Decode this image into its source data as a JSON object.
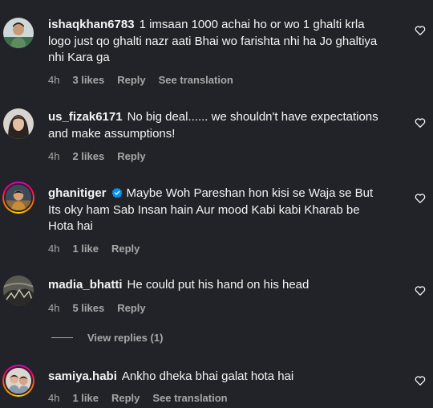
{
  "comments": [
    {
      "username": "ishaqkhan6783",
      "text": "1 imsaan 1000 achai ho or wo 1 ghalti krla logo just qo ghalti nazr aati Bhai wo farishta nhi ha Jo ghaltiya nhi Kara ga",
      "time": "4h",
      "likes": "3 likes",
      "reply": "Reply",
      "translate": "See translation"
    },
    {
      "username": "us_fizak6171",
      "text": "No big deal...... we shouldn't have expectations and make assumptions!",
      "time": "4h",
      "likes": "2 likes",
      "reply": "Reply"
    },
    {
      "username": "ghanitiger",
      "verified": true,
      "text": "Maybe Woh Pareshan hon kisi se Waja se But Its oky ham Sab Insan hain Aur mood Kabi kabi Kharab be Hota hai",
      "time": "4h",
      "likes": "1 like",
      "reply": "Reply"
    },
    {
      "username": "madia_bhatti",
      "text": "He could put his hand on his head",
      "time": "4h",
      "likes": "5 likes",
      "reply": "Reply"
    },
    {
      "username": "samiya.habi",
      "text": "Ankho dheka bhai galat hota hai",
      "time": "4h",
      "likes": "1 like",
      "reply": "Reply",
      "translate": "See translation"
    }
  ],
  "view_replies": "View replies (1)",
  "colors": {
    "background": "#212328",
    "text": "#f5f5f5",
    "meta": "#a8a8a8",
    "verified": "#0095f6"
  },
  "icons": {
    "like": "heart-outline-icon",
    "verified": "verified-badge-icon"
  }
}
